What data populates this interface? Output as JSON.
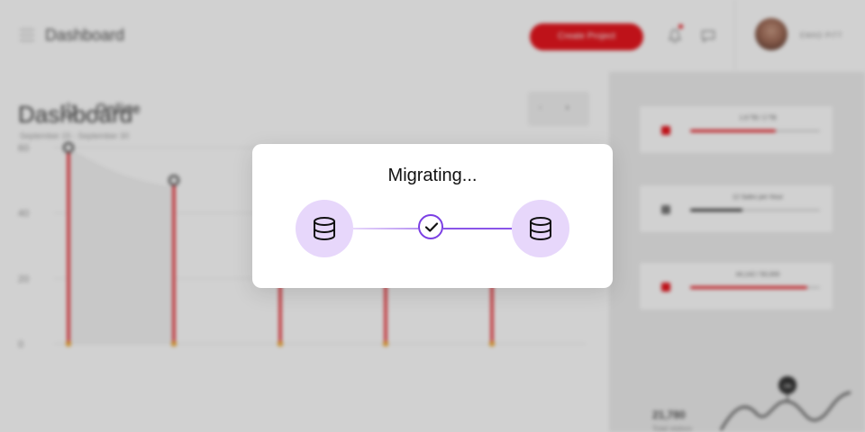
{
  "header": {
    "app_title": "Dashboard",
    "create_button": "Create Project",
    "user_name": "EMAD PITT",
    "icons": [
      "menu-icon",
      "bell-icon",
      "chat-icon"
    ]
  },
  "main": {
    "title": "Dashboard",
    "date_range": "September 15 - September 30",
    "status_label": "Online",
    "nav": {
      "prev": "‹",
      "next": "›"
    }
  },
  "chart_data": {
    "type": "scatter",
    "yticks": [
      "0",
      "20",
      "40",
      "60"
    ],
    "ylim": [
      0,
      60
    ],
    "values": [
      60,
      50,
      30,
      40,
      40
    ],
    "grid": true,
    "color": "#e8171f"
  },
  "sidebar": {
    "cards": [
      {
        "label": "1.6 TB / 2 TB",
        "progress": 0.66,
        "color": "#e8171f"
      },
      {
        "label": "12 Sales per Hour",
        "progress": 0.4,
        "color": "#333333"
      },
      {
        "label": "44,142 / 50,000",
        "progress": 0.9,
        "color": "#e8171f"
      }
    ],
    "total_value": "21,780",
    "total_label": "Total visitors",
    "mini_badge": "28k"
  },
  "modal": {
    "title": "Migrating...",
    "accent": "#7b3fe4",
    "icon_bg": "#e7d7fb"
  }
}
